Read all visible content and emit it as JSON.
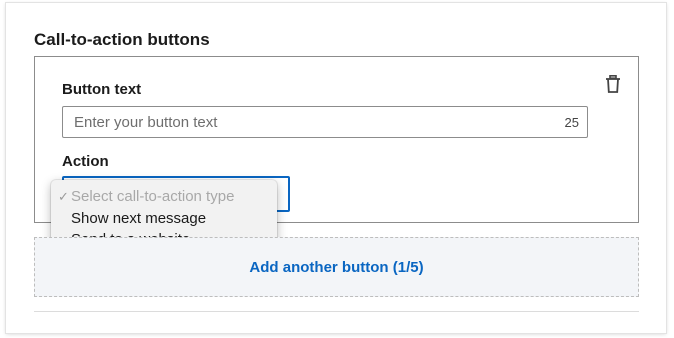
{
  "section": {
    "title": "Call-to-action buttons"
  },
  "button_card": {
    "button_text_label": "Button text",
    "button_text_placeholder": "Enter your button text",
    "char_counter": "25",
    "action_label": "Action",
    "delete_icon": "trash-icon"
  },
  "action_dropdown": {
    "check_mark": "✓",
    "options": [
      {
        "label": "Select call-to-action type",
        "selected": true,
        "disabled": true
      },
      {
        "label": "Show next message",
        "selected": false,
        "disabled": false
      },
      {
        "label": "Send to a website",
        "selected": false,
        "disabled": false
      }
    ]
  },
  "add_button": {
    "label": "Add another button (1/5)"
  },
  "colors": {
    "accent": "#0a66c2",
    "add_area_bg": "#f3f5f8",
    "dropdown_bg": "#f2f2f2"
  }
}
